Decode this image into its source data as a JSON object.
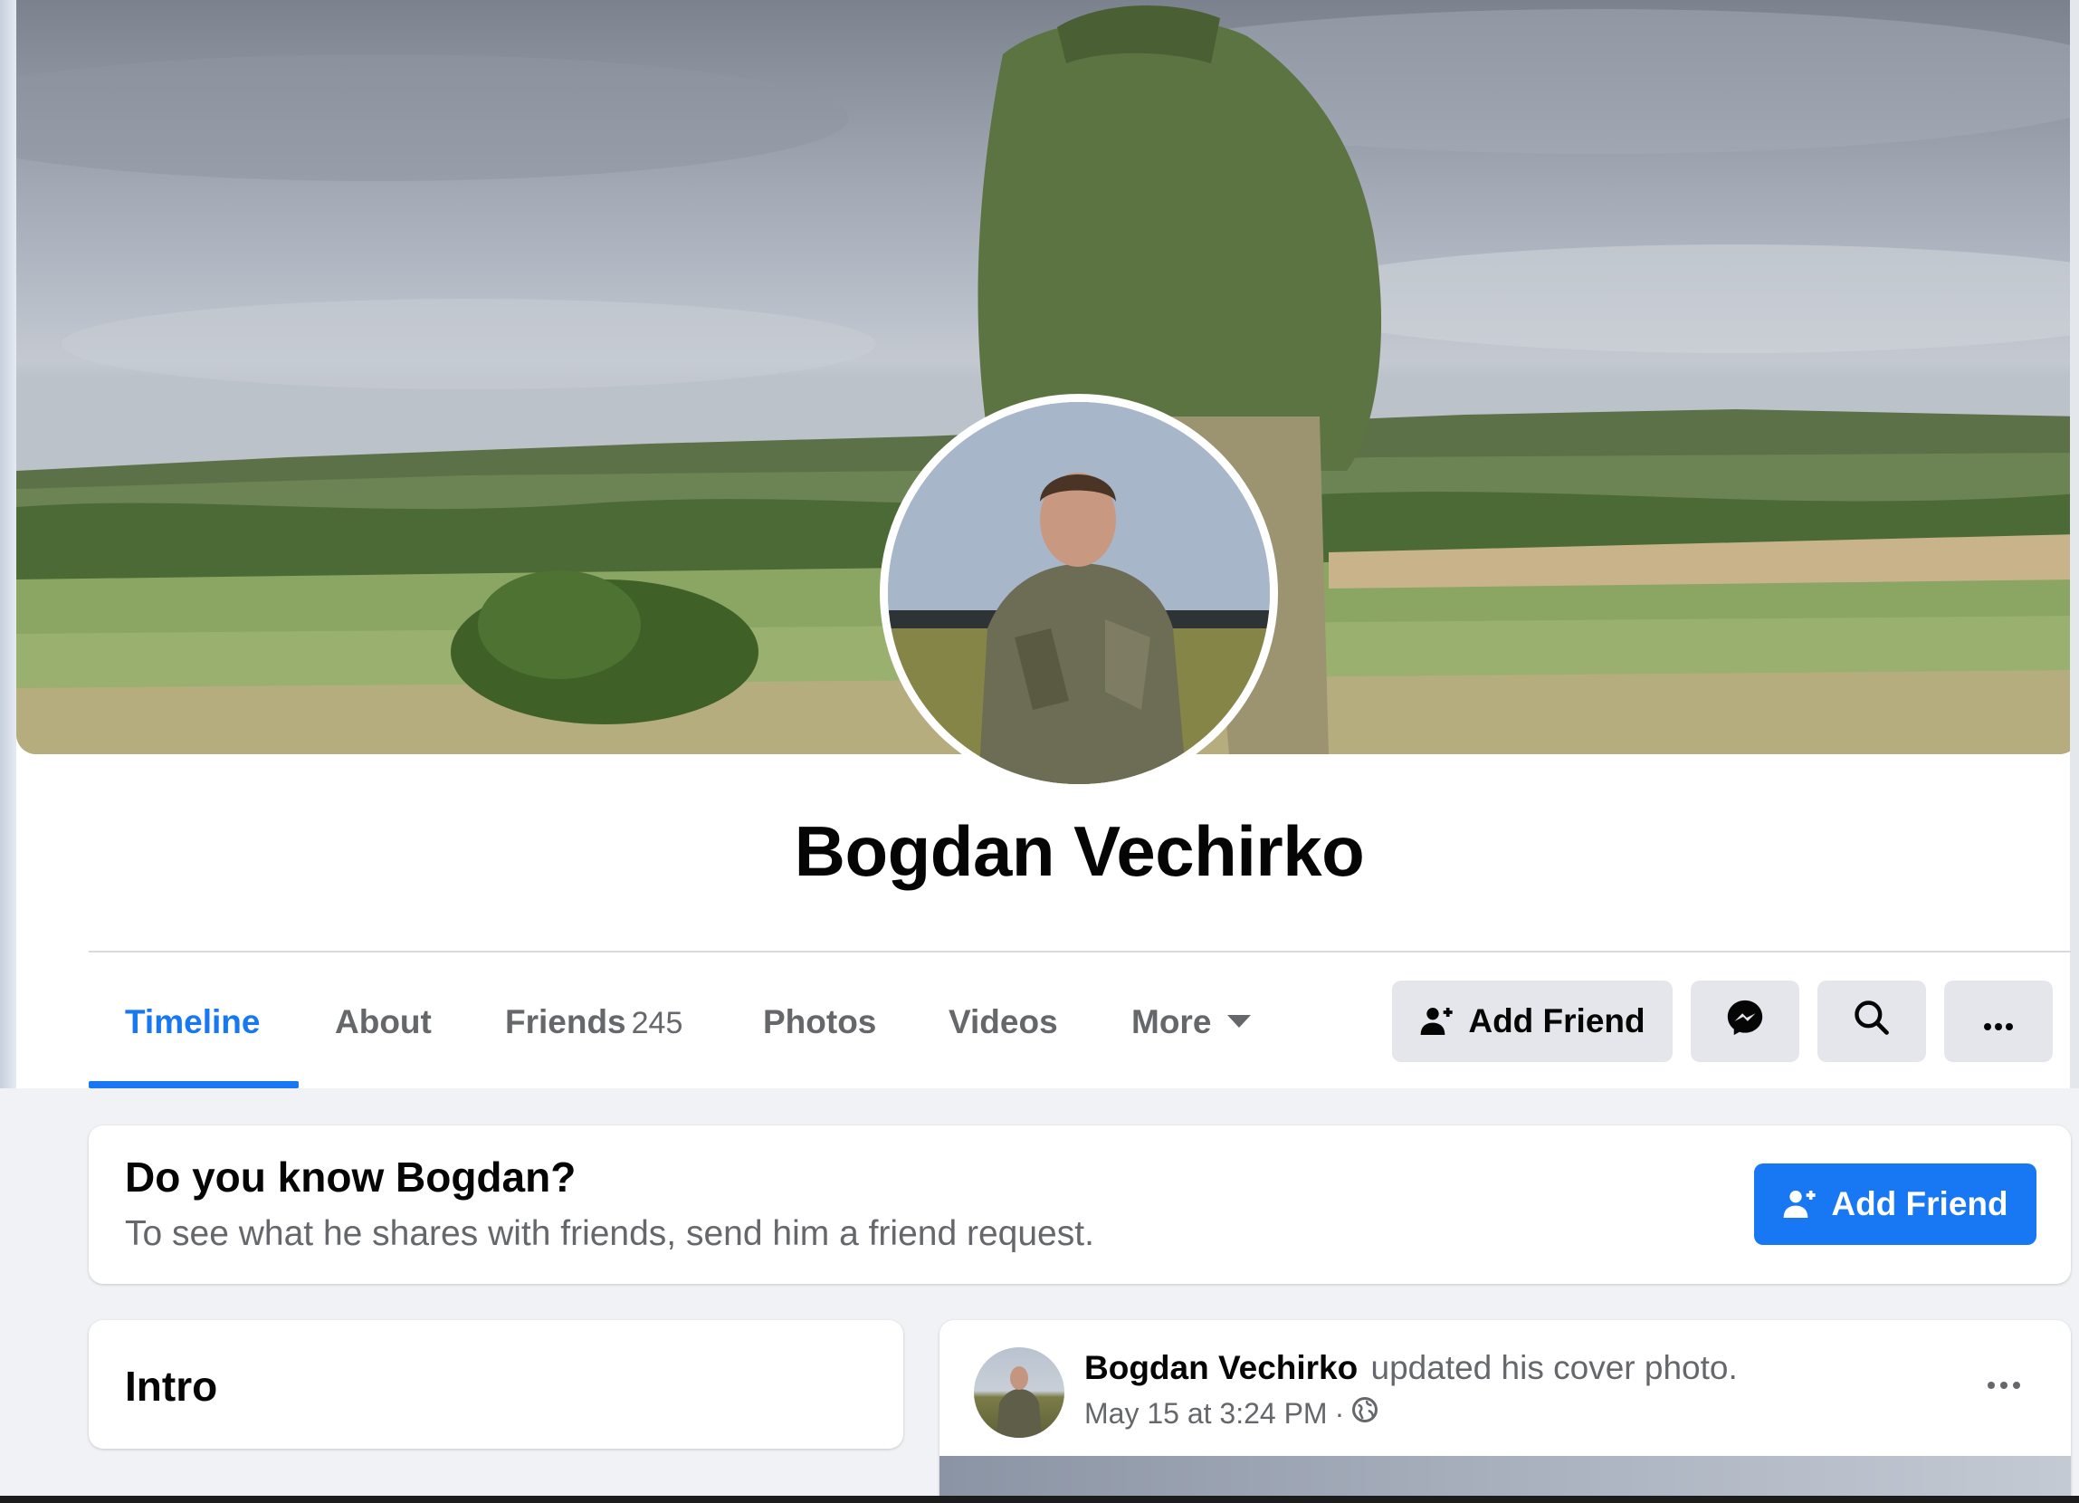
{
  "profile": {
    "name": "Bogdan Vechirko"
  },
  "tabs": [
    {
      "label": "Timeline",
      "active": true
    },
    {
      "label": "About"
    },
    {
      "label": "Friends",
      "count": "245"
    },
    {
      "label": "Photos"
    },
    {
      "label": "Videos"
    },
    {
      "label": "More"
    }
  ],
  "actions": {
    "add_friend": "Add Friend"
  },
  "know_card": {
    "title": "Do you know Bogdan?",
    "subtitle": "To see what he shares with friends, send him a friend request.",
    "button": "Add Friend"
  },
  "intro": {
    "title": "Intro"
  },
  "post": {
    "author": "Bogdan Vechirko",
    "action": "updated his cover photo.",
    "date": "May 15 at 3:24 PM",
    "separator": "·"
  },
  "colors": {
    "brand": "#1877f2",
    "secondary_text": "#65676b",
    "button_bg": "#e4e6eb",
    "page_bg": "#f0f2f5"
  },
  "icons": [
    "add-friend-icon",
    "messenger-icon",
    "search-icon",
    "more-icon",
    "caret-down-icon",
    "globe-icon"
  ]
}
